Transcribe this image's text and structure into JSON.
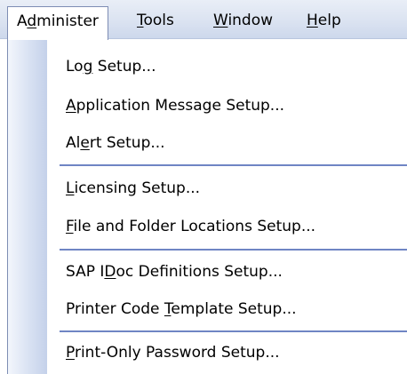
{
  "menubar": {
    "items": [
      {
        "label_pre": "A",
        "label_u": "d",
        "label_post": "minister"
      },
      {
        "label_pre": "",
        "label_u": "T",
        "label_post": "ools"
      },
      {
        "label_pre": "",
        "label_u": "W",
        "label_post": "indow"
      },
      {
        "label_pre": "",
        "label_u": "H",
        "label_post": "elp"
      }
    ],
    "active_index": 0
  },
  "dropdown": {
    "items": [
      {
        "pre": "Lo",
        "u": "g",
        "post": " Setup..."
      },
      {
        "pre": "",
        "u": "A",
        "post": "pplication Message Setup..."
      },
      {
        "pre": "Al",
        "u": "e",
        "post": "rt Setup..."
      },
      {
        "pre": "",
        "u": "L",
        "post": "icensing Setup..."
      },
      {
        "pre": "",
        "u": "F",
        "post": "ile and Folder Locations Setup..."
      },
      {
        "pre": "SAP I",
        "u": "D",
        "post": "oc Definitions Setup..."
      },
      {
        "pre": "Printer Code ",
        "u": "T",
        "post": "emplate Setup..."
      },
      {
        "pre": "",
        "u": "P",
        "post": "rint-Only Password Setup..."
      }
    ]
  },
  "colors": {
    "menubar_bg": "#dbe3f1",
    "gutter": "#c4d1ea",
    "separator": "#6f85c4",
    "border": "#7e8db4"
  }
}
